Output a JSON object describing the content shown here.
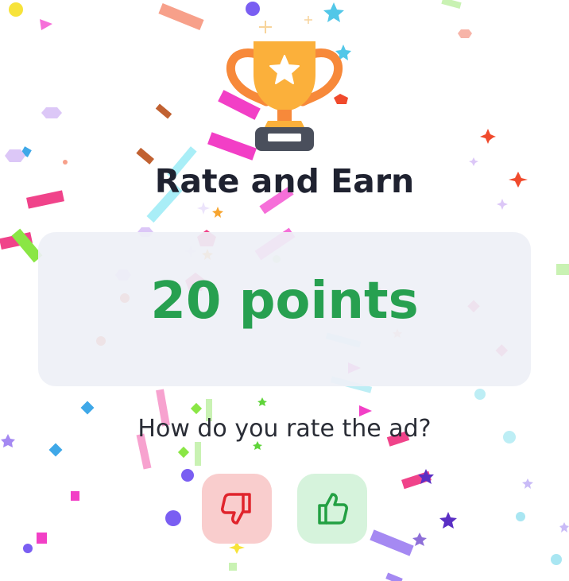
{
  "dialog": {
    "title": "Rate and Earn",
    "points_label": "20 points",
    "question": "How do you rate the ad?"
  },
  "icons": {
    "trophy": "trophy-icon",
    "thumbs_down": "thumbs-down-icon",
    "thumbs_up": "thumbs-up-icon"
  },
  "colors": {
    "title": "#1f2230",
    "points": "#27a050",
    "card_background": "#eef0f6",
    "thumbs_down_bg": "#f9cdcd",
    "thumbs_down_icon": "#e0242c",
    "thumbs_up_bg": "#d6f3dc",
    "thumbs_up_icon": "#23a043",
    "trophy_gold": "#fbb03b",
    "trophy_handles": "#f7893a",
    "trophy_base": "#4a4f5c"
  }
}
